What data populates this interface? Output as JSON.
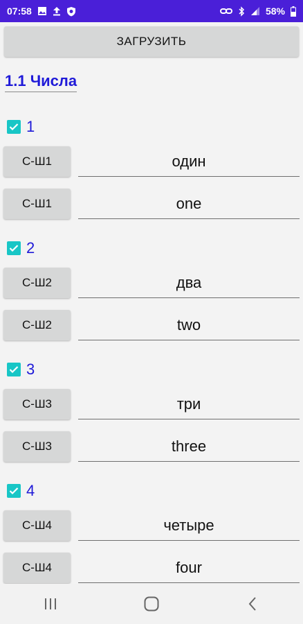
{
  "status_bar": {
    "time": "07:58",
    "battery": "58%",
    "left_icons": [
      "image-icon",
      "upload-icon",
      "shield-icon"
    ],
    "right_icons": [
      "link-icon",
      "bluetooth-icon",
      "signal-icon",
      "battery-icon"
    ]
  },
  "toolbar": {
    "load_label": "ЗАГРУЗИТЬ"
  },
  "section": {
    "title": "1.1 Числа"
  },
  "groups": [
    {
      "number": "1",
      "checked": true,
      "rows": [
        {
          "button": "С-Ш1",
          "word": "один"
        },
        {
          "button": "С-Ш1",
          "word": "one"
        }
      ]
    },
    {
      "number": "2",
      "checked": true,
      "rows": [
        {
          "button": "С-Ш2",
          "word": "два"
        },
        {
          "button": "С-Ш2",
          "word": "two"
        }
      ]
    },
    {
      "number": "3",
      "checked": true,
      "rows": [
        {
          "button": "С-Ш3",
          "word": "три"
        },
        {
          "button": "С-Ш3",
          "word": "three"
        }
      ]
    },
    {
      "number": "4",
      "checked": true,
      "rows": [
        {
          "button": "С-Ш4",
          "word": "четыре"
        },
        {
          "button": "С-Ш4",
          "word": "four"
        }
      ]
    }
  ],
  "nav_bar": {
    "buttons": [
      "recent-apps-icon",
      "home-icon",
      "back-icon"
    ]
  },
  "colors": {
    "status_bar": "#4a1fd8",
    "accent_text": "#1f1ad8",
    "checkbox": "#18c6c6",
    "button_bg": "#d6d7d7",
    "background": "#f3f3f3"
  }
}
